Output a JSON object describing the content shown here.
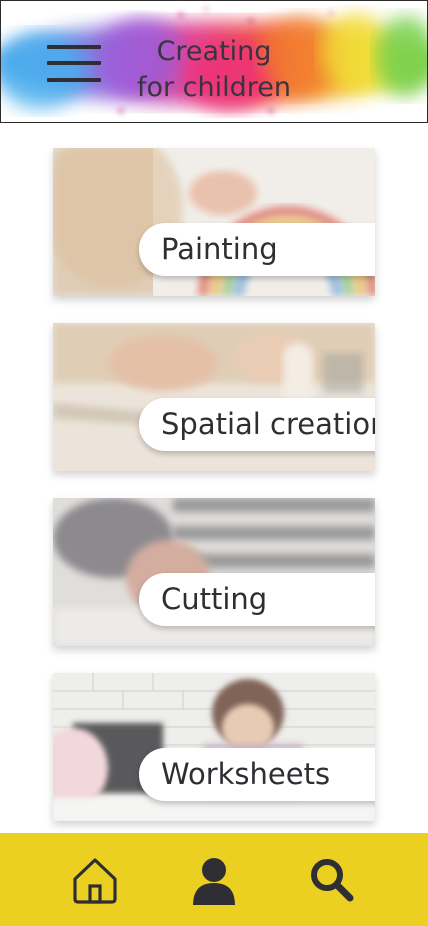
{
  "header": {
    "title_line1": "Creating",
    "title_line2": "for children",
    "menu_icon": "hamburger-menu-icon"
  },
  "categories": [
    {
      "label": "Painting"
    },
    {
      "label": "Spatial creation"
    },
    {
      "label": "Cutting"
    },
    {
      "label": "Worksheets"
    }
  ],
  "bottom_nav": {
    "items": [
      {
        "icon": "home-icon"
      },
      {
        "icon": "profile-icon"
      },
      {
        "icon": "search-icon"
      }
    ]
  },
  "colors": {
    "nav_background": "#ebcf21",
    "icon": "#2f2f33",
    "text": "#2f2f33"
  }
}
